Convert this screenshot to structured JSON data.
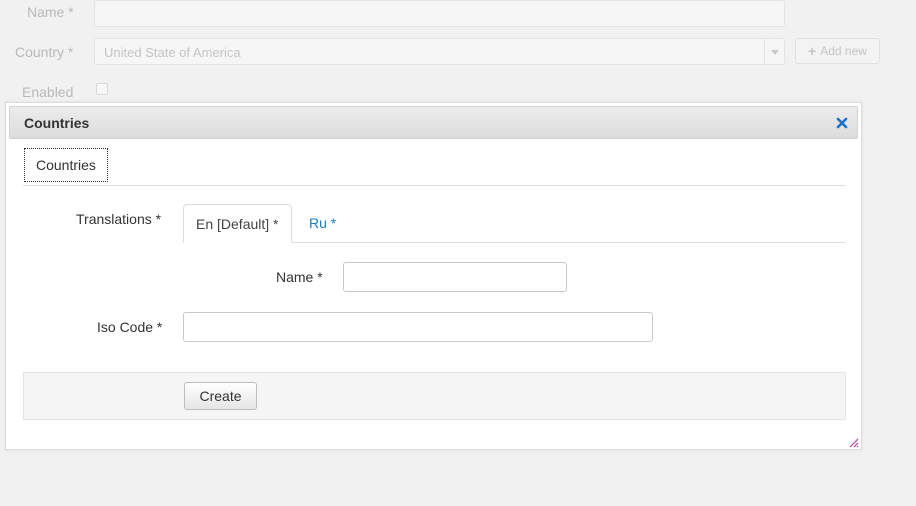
{
  "background_form": {
    "name_label": "Name *",
    "country_label": "Country *",
    "country_value": "United State of America",
    "add_new_label": "Add new",
    "enabled_label": "Enabled"
  },
  "dialog": {
    "title": "Countries",
    "outer_tab": "Countries",
    "translations_label": "Translations *",
    "tabs": [
      {
        "label": "En [Default] *",
        "active": true
      },
      {
        "label": "Ru *",
        "active": false
      }
    ],
    "name_label": "Name *",
    "name_value": "",
    "iso_code_label": "Iso Code *",
    "iso_code_value": "",
    "create_label": "Create"
  },
  "colors": {
    "link": "#1a7fc1",
    "close_icon": "#1f6fc5",
    "resize_handle": "#c03ca8"
  }
}
